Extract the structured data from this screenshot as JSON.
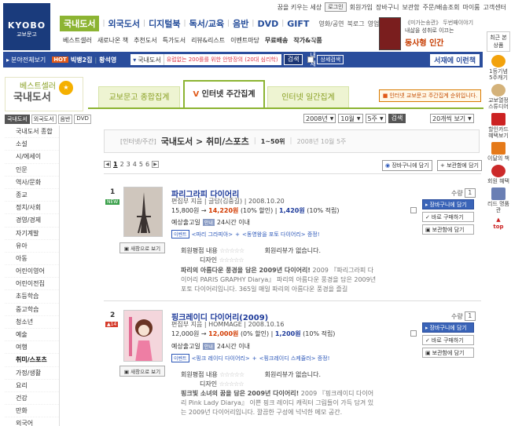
{
  "header": {
    "logo_text": "KYOBO",
    "logo_sub": "교보문고",
    "slogan": "꿈을 키우는 세상",
    "login": "로그인",
    "util_links": [
      "회원가입",
      "장바구니",
      "보관함",
      "주문/배송조회",
      "마이룸",
      "고객센터"
    ],
    "gnb_main": [
      "국내도서",
      "외국도서",
      "디지털북",
      "독서/교육",
      "음반",
      "DVD",
      "GIFT"
    ],
    "gnb_sub": [
      "영화/공연",
      "북로그",
      "영업점"
    ],
    "sub_nav": [
      "베스트셀러",
      "새로나온 책",
      "추천도서",
      "특가도서",
      "리뷰&리스트",
      "이벤트마당",
      "무료배송",
      "작가&작품"
    ],
    "promo": {
      "line1": "《미가는송관》 두번째이야기",
      "line2": "내삶을 성취로 이끄는",
      "line3": "동사형 인간"
    }
  },
  "search": {
    "all_category": "분야전체보기",
    "hot_label": "HOT",
    "hot_keywords": [
      "빅뱅2집",
      "황석영"
    ],
    "scope": "국내도서",
    "query": "유럽없는 200를를 위한 안방장의 (20대 심리학)",
    "search_btn": "검색",
    "within_label": "결과내재검색",
    "detail_btn": "상세검색",
    "shelf_btn": "서재에 이런책"
  },
  "rail": {
    "recent_label": "최근 본 상품",
    "items": [
      "1등기념 5주캐기",
      "교보열정 스튜디어",
      "할인카드 혜택보기",
      "이달의 책",
      "회원 혜택",
      "리드 명품관",
      "top"
    ]
  },
  "page": {
    "title_small": "베스트셀러",
    "title_big": "국내도서",
    "tabs": [
      "교보문고 종합집계",
      "인터넷 주간집계",
      "인터넷 일간집계"
    ],
    "note": "인터넷 교보문고 주간집계 순위입니다."
  },
  "left_nav": {
    "tabs": [
      "국내도서",
      "외국도서",
      "음반",
      "DVD"
    ],
    "items": [
      "국내도서 종합",
      "소설",
      "시/에세이",
      "인문",
      "역사/문화",
      "종교",
      "정치/사회",
      "경영/경제",
      "자기계발",
      "유아",
      "아동",
      "어린이영어",
      "어린이전집",
      "초등학습",
      "중고학습",
      "청소년",
      "예술",
      "여행",
      "취미/스포츠",
      "가정/생활",
      "요리",
      "건강",
      "만화",
      "외국어",
      "사전",
      "과학",
      "컴퓨터/IT",
      "기술/공학",
      "잡지"
    ]
  },
  "filters": {
    "year": "2008년",
    "month": "10월",
    "week": "5주",
    "go": "검색",
    "per_page": "20개씩 보기"
  },
  "heading": {
    "crumb": "[인터넷/주간]",
    "path": "국내도서 > 취미/스포츠",
    "range": "1~50위",
    "period": "2008년 10월 5주"
  },
  "pager": {
    "current": "1",
    "pages": [
      "2",
      "3",
      "4",
      "5",
      "6"
    ],
    "cart_btn": "장바구니에 담기",
    "keep_btn": "보관함에 담기"
  },
  "items": [
    {
      "rank": "1",
      "flag": "NEW",
      "title": "파리그라피 다이어리",
      "author": "편집부 지음 | 글담(김중길) | 2008.10.20",
      "price": "15,800원",
      "sale": "14,220원",
      "discount": "(10% 할인)",
      "point": "1,420원",
      "point_rate": "(10% 적립)",
      "ship_label": "예상출고일",
      "ship_badge": "안내",
      "ship_value": "24시간 이내",
      "event_badge": "이벤트",
      "events": [
        "<파리 그라피아>",
        "<동영왕을 포토 다이어리> 증정!"
      ],
      "review_label": "회원평점 내용",
      "review_label2": "디자인",
      "review_empty": "회원리뷰가 없습니다.",
      "desc_bold": "파리의 아름다운 풍경을 담은 2009년 다이어리!",
      "desc": "2009 『파리그라피 다이어리 PARIS GRAPHY Diarya』 파리의 아름다운 풍경을 담은 2009년 포토 다이어리입니다. 365일 매일 파리의 아름다운 풍경을 즐길",
      "zoom": "새창으로 보기"
    },
    {
      "rank": "2",
      "flag": "▲14",
      "title": "핑크레이디 다이어리(2009)",
      "author": "편집부 지음 | HOMMAGE | 2008.10.16",
      "price": "12,000원",
      "sale": "12,000원",
      "discount": "(0% 할인)",
      "point": "1,200원",
      "point_rate": "(10% 적립)",
      "ship_label": "예상출고일",
      "ship_badge": "안내",
      "ship_value": "24시간 이내",
      "event_badge": "이벤트",
      "events": [
        "<핑크 레이디 다이어리>",
        "<핑크레이디 스케쥴러> 증정!"
      ],
      "review_label": "회원평점 내용",
      "review_label2": "디자인",
      "review_empty": "회원리뷰가 없습니다.",
      "desc_bold": "핑크빛 소녀의 꿈을 담은 2009년 다이어리!",
      "desc": "2009 『핑크레이디 다이어리 Pink Lady Diarya』 이쁜 핑크 레이디 캐릭터 그림들이 가득 담겨 있는 2009년 다이어리입니다. 깔끔한 구성에 넉넉한 메모 공간.",
      "zoom": "새창으로 보기"
    }
  ],
  "item_actions": {
    "qty_label": "수량",
    "qty_value": "1",
    "cart": "장바구니에 담기",
    "buy": "바로 구매하기",
    "keep": "보관함에 담기"
  }
}
